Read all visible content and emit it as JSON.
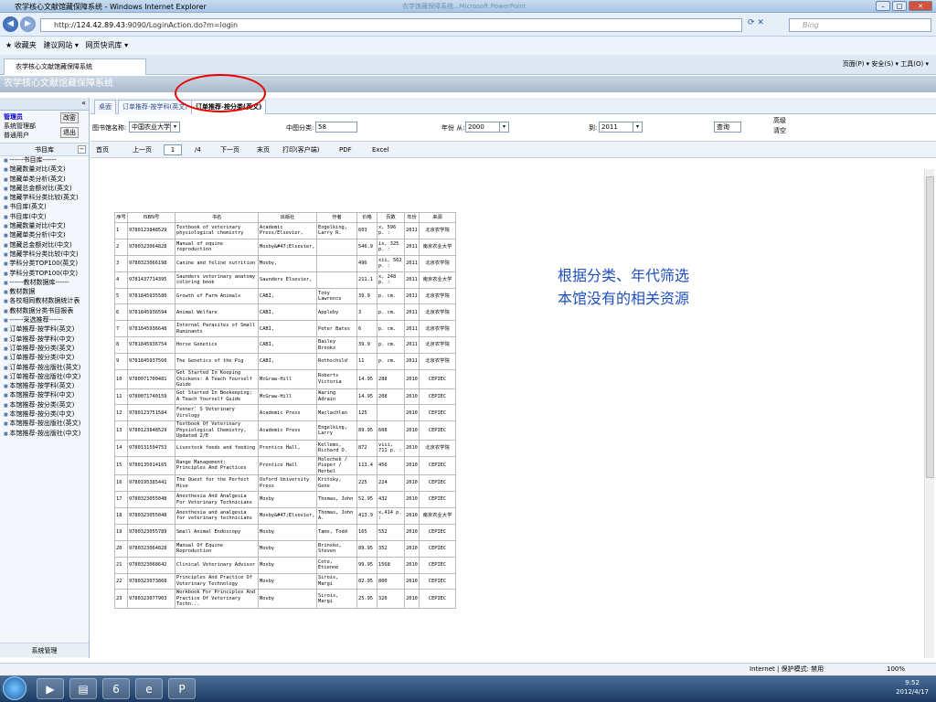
{
  "window": {
    "title": "农学核心文献馆藏保障系统 - Windows Internet Explorer",
    "blur": "农学馆藏保障系统...Microsoft PowerPoint"
  },
  "address": {
    "prefix": "http://",
    "host": "124.42.89.43",
    "path": ":9090/LoginAction.do?m=login",
    "search": "Bing"
  },
  "favorites": {
    "fav": "收藏夹",
    "suggest": "建议网站 ▾",
    "slice": "网页快讯库 ▾"
  },
  "tab": {
    "label": "农学核心文献馆藏保障系统",
    "tools": "页面(P) ▾  安全(S) ▾  工具(O) ▾"
  },
  "app": {
    "title": "农学核心文献馆藏保障系统"
  },
  "user": {
    "admin": "管理员",
    "role1": "系统管理部",
    "role2": "普通用户",
    "pwd": "改密",
    "logout": "退出"
  },
  "sidebar": {
    "title": "书目库",
    "footer": "系统管理",
    "items": [
      "------书目库------",
      "馆藏数量对比(英文)",
      "馆藏单类分析(英文)",
      "馆藏总金额对比(英文)",
      "馆藏学科分类比较(英文)",
      "书目库(英文)",
      "书目库(中文)",
      "馆藏数量对比(中文)",
      "馆藏单类分析(中文)",
      "馆藏总金额对比(中文)",
      "馆藏学科分类比较(中文)",
      "学科分类TOP100(英文)",
      "学科分类TOP100(中文)",
      "------教材数据库------",
      "教材数据",
      "各校相同教材数据统计表",
      "教材数据分类书目报表",
      "------采选推荐------",
      "订单推荐-按学科(英文)",
      "订单推荐-按学科(中文)",
      "订单推荐-按分类(英文)",
      "订单推荐-按分类(中文)",
      "订单推荐-按出版社(英文)",
      "订单推荐-按出版社(中文)",
      "本馆推荐-按学科(英文)",
      "本馆推荐-按学科(中文)",
      "本馆推荐-按分类(英文)",
      "本馆推荐-按分类(中文)",
      "本馆推荐-按出版社(英文)",
      "本馆推荐-按出版社(中文)"
    ]
  },
  "tabs": [
    "桌面",
    "订单推荐-按学科(英文)",
    "订单推荐-按分类(英文)"
  ],
  "filter": {
    "lib_label": "图书馆名称:",
    "lib": "中国农业大学",
    "cls_label": "中图分类:",
    "cls": "58",
    "year_label": "年份 从:",
    "from": "2000",
    "to_label": "到:",
    "to": "2011",
    "query": "查询",
    "adv": "高级",
    "clear": "清空"
  },
  "pager": {
    "first": "首页",
    "prev": "上一页",
    "page": "1",
    "total": "/4",
    "next": "下一页",
    "last": "末页",
    "print": "打印(客户端)",
    "pdf": "PDF",
    "excel": "Excel"
  },
  "table": {
    "headers": [
      "序号",
      "ISBN号",
      "书名",
      "出版社",
      "作者",
      "价格",
      "页数",
      "年份",
      "来源"
    ],
    "rows": [
      [
        "1",
        "9780123848529",
        "Textbook of veterinary physiological chemistry",
        "Academic Press/Elsevier,",
        "Engelking, Larry R.",
        "603",
        "x, 596 p. :",
        "2011",
        "北京农学院"
      ],
      [
        "2",
        "9780323064828",
        "Manual of equine reproduction",
        "Mosby&#47;Elsevier,",
        "",
        "546.9",
        "ix, 325 p. :",
        "2011",
        "南京农业大学"
      ],
      [
        "3",
        "9780323066198",
        "Canine and feline nutrition",
        "Mosby,",
        "",
        "496",
        "xii, 562 p. :",
        "2011",
        "北京农学院"
      ],
      [
        "4",
        "9781437714395",
        "Saunders veterinary anatomy coloring book",
        "Saunders Elsevier,",
        "",
        "211.1",
        "x, 248 p. :",
        "2011",
        "南京农业大学"
      ],
      [
        "5",
        "9781845935580",
        "Growth of Farm Animals",
        "CABI,",
        "Tony Lawrence",
        "39.9",
        "p. cm.",
        "2011",
        "北京农学院"
      ],
      [
        "6",
        "9781845936594",
        "Animal Welfare",
        "CABI,",
        "Appleby",
        "3",
        "p. cm.",
        "2011",
        "北京农学院"
      ],
      [
        "7",
        "9781845936648",
        "Internal Parasites of Small Ruminants",
        "CABI,",
        "Peter Bates",
        "6",
        "p. cm.",
        "2011",
        "北京农学院"
      ],
      [
        "8",
        "9781845936754",
        "Horse Genetics",
        "CABI,",
        "Bailey Brooks",
        "39.9",
        "p. cm.",
        "2011",
        "北京农学院"
      ],
      [
        "9",
        "9781845937560",
        "The Genetics of the Pig",
        "CABI,",
        "Rothschild",
        "11",
        "p. cm.",
        "2011",
        "北京农学院"
      ],
      [
        "10",
        "9780071700481",
        "Get Started In Keeping Chickens: A Teach Yourself Guide",
        "McGraw-Hill",
        "Roberts Victoria",
        "14.95",
        "288",
        "2010",
        "CEPIEC"
      ],
      [
        "11",
        "9780071740159",
        "Get Started In Beekeeping: A Teach Yourself Guide",
        "McGraw-Hill",
        "Waring Adrain",
        "14.95",
        "208",
        "2010",
        "CEPIEC"
      ],
      [
        "12",
        "9780123751584",
        "Fenner' S Veterinary Virology",
        "Academic Press",
        "Maclachlan",
        "125",
        "",
        "2010",
        "CEPIEC"
      ],
      [
        "13",
        "9780123848529",
        "Textbook Of Veterinary Physiological Chemistry, Updated 2/E",
        "Academic Press",
        "Engelking, Larry",
        "89.95",
        "608",
        "2010",
        "CEPIEC"
      ],
      [
        "14",
        "9780131594753",
        "Livestock feeds and feeding",
        "Prentice Hall,",
        "Kellems, Richard O.",
        "872",
        "viii, 711 p. :",
        "2010",
        "北京农学院"
      ],
      [
        "15",
        "9780135014165",
        "Range Management: Principles And Practices",
        "Prentice Hall",
        "Holechek / Pieper / Herbel",
        "113.4",
        "456",
        "2010",
        "CEPIEC"
      ],
      [
        "16",
        "9780195385441",
        "The Quest for the Perfect Hive",
        "Oxford University Press",
        "Kritsky, Gene",
        "225",
        "224",
        "2010",
        "CEPIEC"
      ],
      [
        "17",
        "9780323055048",
        "Anesthesia And Analgesia For Veterinary Technicians",
        "Mosby",
        "Thomas, John",
        "52.95",
        "432",
        "2010",
        "CEPIEC"
      ],
      [
        "18",
        "9780323055048",
        "Anesthesia and analgesia for veterinary technicians",
        "Mosby&#47;Elsevier,",
        "Thomas, John A.",
        "413.9",
        "x,414 p. :",
        "2010",
        "南京农业大学"
      ],
      [
        "19",
        "9780323055789",
        "Small Animal Endoscopy",
        "Mosby",
        "Tams, Todd",
        "165",
        "552",
        "2010",
        "CEPIEC"
      ],
      [
        "20",
        "9780323064828",
        "Manual Of Equine Reproduction",
        "Mosby",
        "Brinsko, Steven",
        "89.95",
        "352",
        "2010",
        "CEPIEC"
      ],
      [
        "21",
        "9780323068642",
        "Clinical Veterinary Advisor",
        "Mosby",
        "Cote, Etienne",
        "99.95",
        "1568",
        "2010",
        "CEPIEC"
      ],
      [
        "22",
        "9780323073868",
        "Principles And Practice Of Veterinary Technology",
        "Mosby",
        "Sirois, Margi",
        "82.95",
        "800",
        "2010",
        "CEPIEC"
      ],
      [
        "23",
        "9780323077903",
        "Workbook For Principles And Practice Of Veterinary Techn...",
        "Mosby",
        "Sirois, Margi",
        "25.95",
        "320",
        "2010",
        "CEPIEC"
      ]
    ]
  },
  "note": {
    "line1": "根据分类、年代筛选",
    "line2": "本馆没有的相关资源"
  },
  "status": {
    "zone": "Internet | 保护模式: 禁用",
    "zoom": "100%"
  },
  "clock": {
    "time": "9:52",
    "date": "2012/4/17"
  },
  "accent": "#1f4fbf"
}
